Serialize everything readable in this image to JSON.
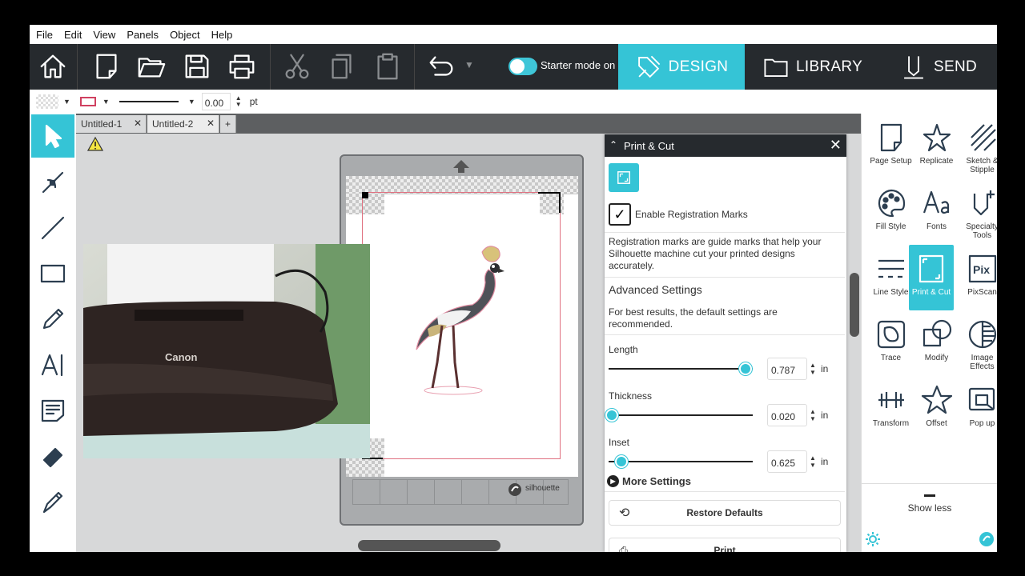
{
  "menu": [
    "File",
    "Edit",
    "View",
    "Panels",
    "Object",
    "Help"
  ],
  "toolbar": {
    "starter_label": "Starter mode on",
    "design_label": "DESIGN",
    "library_label": "LIBRARY",
    "send_label": "SEND"
  },
  "propbar": {
    "line_width": "0.00",
    "unit": "pt"
  },
  "doc_tabs": [
    {
      "label": "Untitled-1"
    },
    {
      "label": "Untitled-2"
    }
  ],
  "right_panel": {
    "items": [
      "Page Setup",
      "Replicate",
      "Sketch & Stipple",
      "Fill Style",
      "Fonts",
      "Specialty Tools",
      "Line Style",
      "Print & Cut",
      "PixScan",
      "Trace",
      "Modify",
      "Image Effects",
      "Transform",
      "Offset",
      "Pop up"
    ],
    "show_less": "Show less"
  },
  "print_cut": {
    "title": "Print & Cut",
    "enable_label": "Enable Registration Marks",
    "enable_checked": true,
    "description": "Registration marks are guide marks that help your Silhouette machine cut your printed designs accurately.",
    "advanced_title": "Advanced Settings",
    "advanced_desc": "For best results, the default settings are recommended.",
    "length_label": "Length",
    "length_value": "0.787",
    "length_fraction": 0.95,
    "thickness_label": "Thickness",
    "thickness_value": "0.020",
    "thickness_fraction": 0.02,
    "inset_label": "Inset",
    "inset_value": "0.625",
    "inset_fraction": 0.09,
    "unit": "in",
    "more_settings": "More Settings",
    "restore_defaults": "Restore Defaults",
    "print": "Print"
  },
  "mat": {
    "brand": "silhouette"
  },
  "photo": {
    "brand": "Canon"
  }
}
